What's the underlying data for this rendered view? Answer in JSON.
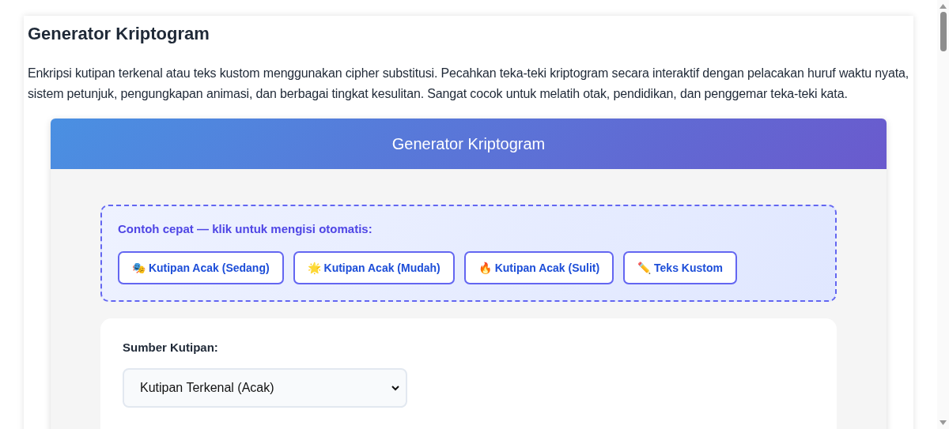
{
  "page": {
    "title": "Generator Kriptogram",
    "description": "Enkripsi kutipan terkenal atau teks kustom menggunakan cipher substitusi. Pecahkan teka-teki kriptogram secara interaktif dengan pelacakan huruf waktu nyata, sistem petunjuk, pengungkapan animasi, dan berbagai tingkat kesulitan. Sangat cocok untuk melatih otak, pendidikan, dan penggemar teka-teki kata."
  },
  "widget": {
    "header": "Generator Kriptogram",
    "examples": {
      "label": "Contoh cepat — klik untuk mengisi otomatis:",
      "buttons": [
        {
          "label": "🎭 Kutipan Acak (Sedang)"
        },
        {
          "label": "🌟 Kutipan Acak (Mudah)"
        },
        {
          "label": "🔥 Kutipan Acak (Sulit)"
        },
        {
          "label": "✏️ Teks Kustom"
        }
      ]
    },
    "source": {
      "label": "Sumber Kutipan:",
      "value": "Kutipan Terkenal (Acak)"
    }
  }
}
